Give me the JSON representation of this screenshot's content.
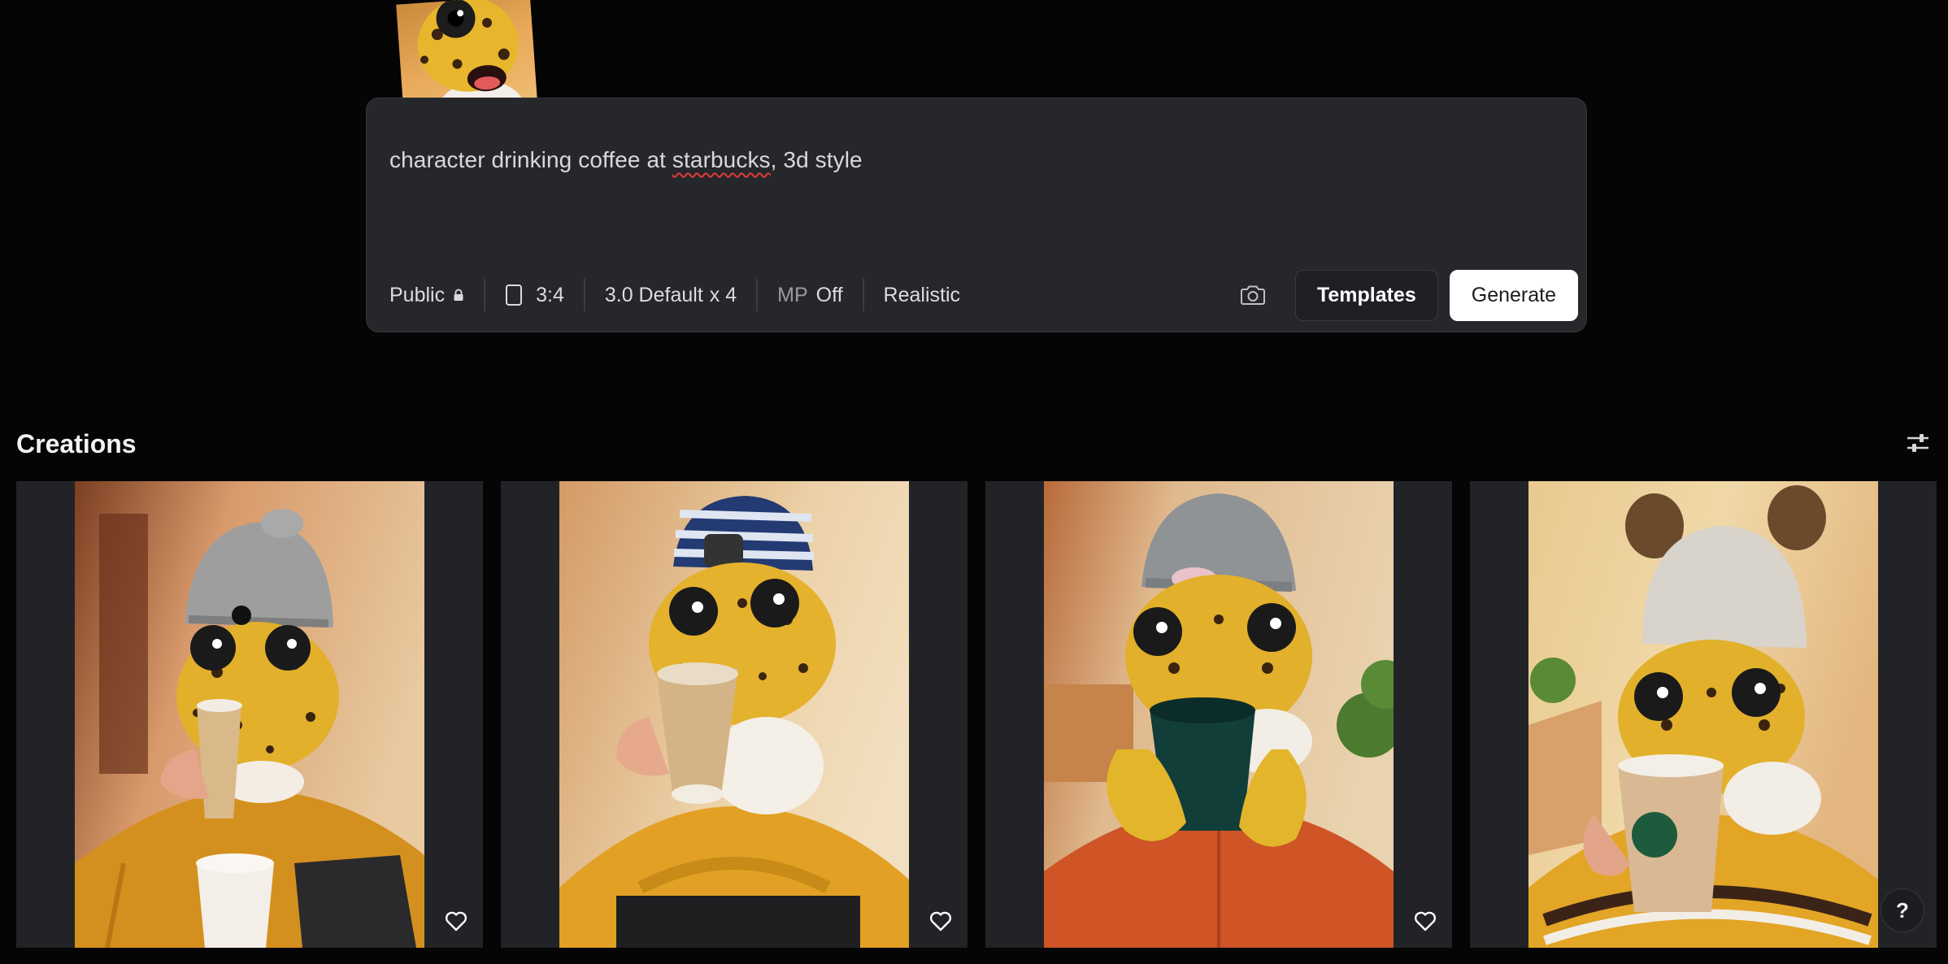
{
  "prompt": {
    "text_before": "character drinking coffee at ",
    "text_misspelled": "starbucks",
    "text_after": ", 3d style"
  },
  "toolbar": {
    "visibility_label": "Public",
    "aspect_ratio": "3:4",
    "model_label": "3.0 Default",
    "count_label": "x 4",
    "mp_prefix": "MP",
    "mp_value": "Off",
    "style_label": "Realistic",
    "templates_label": "Templates",
    "generate_label": "Generate"
  },
  "creations": {
    "title": "Creations",
    "items": [
      {
        "hat": "grey-beanie",
        "cup": "paper-cup"
      },
      {
        "hat": "striped-beanie",
        "cup": "paper-cup"
      },
      {
        "hat": "grey-beanie",
        "cup": "green-cup"
      },
      {
        "hat": "eared-beanie",
        "cup": "logo-cup"
      }
    ]
  },
  "help": {
    "label": "?"
  },
  "colors": {
    "background": "#050505",
    "panel": "#26272b",
    "card": "#222327",
    "generate_bg": "#ffffff",
    "accent_yellow": "#e8b62c"
  }
}
